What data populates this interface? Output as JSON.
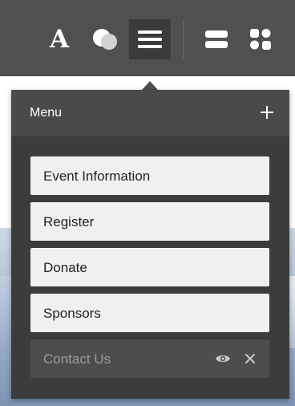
{
  "toolbar": {
    "font_tool_glyph": "A",
    "tools": [
      "font-icon",
      "palette-icon",
      "menu-icon",
      "layout-icon",
      "widgets-icon"
    ],
    "active_tool": "menu-icon",
    "background": "#505050"
  },
  "menu_panel": {
    "title": "Menu",
    "add_glyph": "+",
    "items": [
      {
        "label": "Event Information",
        "hidden": false
      },
      {
        "label": "Register",
        "hidden": false
      },
      {
        "label": "Donate",
        "hidden": false
      },
      {
        "label": "Sponsors",
        "hidden": false
      },
      {
        "label": "Contact Us",
        "hidden": true,
        "actions": [
          "eye-icon",
          "close-icon"
        ]
      }
    ]
  },
  "colors": {
    "panel_bg": "#3c3c3c",
    "panel_header": "#4a4a4a",
    "item_bg": "#f0f0f0",
    "hidden_item_bg": "#4d4d4d"
  }
}
